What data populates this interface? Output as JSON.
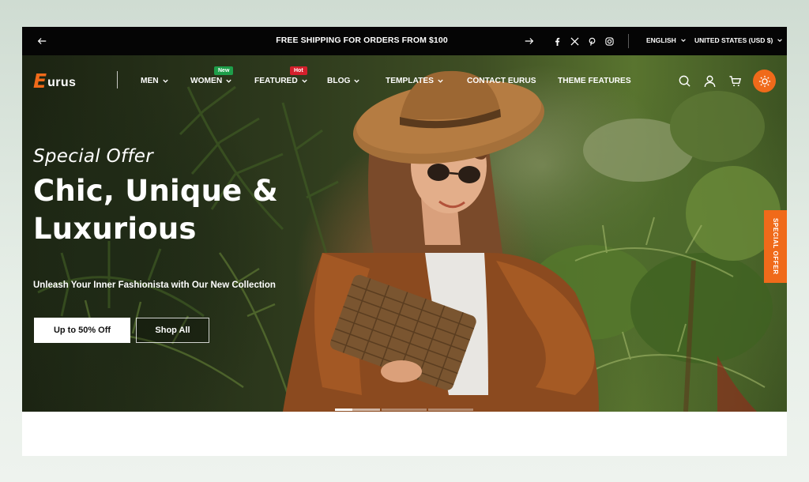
{
  "announcement": {
    "message": "FREE SHIPPING FOR ORDERS FROM $100",
    "language": "ENGLISH",
    "country": "UNITED STATES (USD $)",
    "social_icons": [
      "facebook-icon",
      "x-twitter-icon",
      "pinterest-icon",
      "instagram-icon"
    ]
  },
  "header": {
    "logo_first": "E",
    "logo_rest": "urus",
    "nav": [
      {
        "label": "MEN"
      },
      {
        "label": "WOMEN",
        "badge": "New"
      },
      {
        "label": "FEATURED",
        "badge": "Hot"
      },
      {
        "label": "BLOG"
      },
      {
        "label": "TEMPLATES"
      },
      {
        "label": "CONTACT EURUS"
      },
      {
        "label": "THEME FEATURES"
      }
    ],
    "icons": [
      "search-icon",
      "account-icon",
      "cart-icon",
      "sun-icon"
    ]
  },
  "hero": {
    "eyebrow": "Special Offer",
    "title_line1": "Chic, Unique &",
    "title_line2": "Luxurious",
    "subtitle": "Unleash Your Inner Fashionista with Our New Collection",
    "cta_primary": "Up to 50% Off",
    "cta_secondary": "Shop All",
    "side_tab": "SPECIAL OFFER",
    "slide_count": 3,
    "active_slide": 1
  },
  "colors": {
    "accent": "#f06a1a",
    "badge_new": "#1e9e4a",
    "badge_hot": "#d4202c",
    "announcement_bg": "#050505"
  }
}
